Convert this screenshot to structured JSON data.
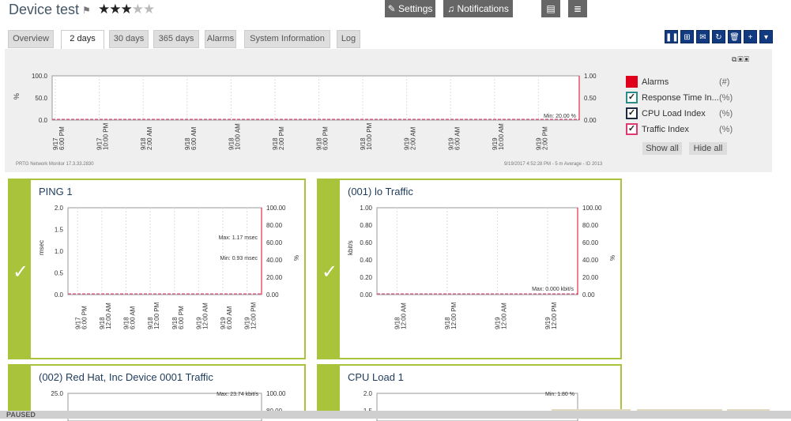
{
  "header": {
    "title": "Device test",
    "rating": 3,
    "rating_max": 5
  },
  "tabs": [
    {
      "label": "Overview"
    },
    {
      "label": "2 days",
      "active": true
    },
    {
      "label": "30 days"
    },
    {
      "label": "365 days"
    },
    {
      "label": "Alarms"
    },
    {
      "label": "System Information"
    },
    {
      "label": "Log"
    }
  ],
  "buttons": {
    "settings": "Settings",
    "notifications": "Notifications"
  },
  "toolbar_icons": [
    "pause-icon",
    "add-ticket-icon",
    "email-icon",
    "refresh-icon",
    "delete-icon",
    "add-icon",
    "dropdown-icon"
  ],
  "overview_chart": {
    "type": "line",
    "y_left": {
      "label": "%",
      "ticks": [
        "100.0",
        "50.0",
        "0.0"
      ]
    },
    "y_right": {
      "label": "#",
      "ticks": [
        "1.00",
        "0.50",
        "0.00"
      ]
    },
    "x_ticks": [
      [
        "9/17",
        "6:00 PM"
      ],
      [
        "9/17",
        "10:00 PM"
      ],
      [
        "9/18",
        "2:00 AM"
      ],
      [
        "9/18",
        "6:00 AM"
      ],
      [
        "9/18",
        "10:00 AM"
      ],
      [
        "9/18",
        "2:00 PM"
      ],
      [
        "9/18",
        "6:00 PM"
      ],
      [
        "9/18",
        "10:00 PM"
      ],
      [
        "9/19",
        "2:00 AM"
      ],
      [
        "9/19",
        "6:00 AM"
      ],
      [
        "9/19",
        "10:00 AM"
      ],
      [
        "9/19",
        "2:00 PM"
      ]
    ],
    "annotation": "Min: 20.00 %",
    "footer_left": "PRTG Network Monitor 17.3.33.2830",
    "footer_right": "9/19/2017 4:52:28 PM - 5 m Average - ID 2013",
    "colors": {
      "alarms": "#e0001c",
      "response": "#2a8b8b",
      "cpu": "#1b2a40",
      "traffic": "#e0396e"
    }
  },
  "legend": {
    "items": [
      {
        "label": "Alarms",
        "unit": "(#)",
        "checked": false
      },
      {
        "label": "Response Time In...",
        "unit": "(%)",
        "checked": true
      },
      {
        "label": "CPU Load Index",
        "unit": "(%)",
        "checked": true
      },
      {
        "label": "Traffic Index",
        "unit": "(%)",
        "checked": true
      }
    ],
    "show_all": "Show all",
    "hide_all": "Hide all"
  },
  "sensors": [
    {
      "title": "PING 1",
      "y_left_label": "msec",
      "y_left_ticks": [
        "2.0",
        "1.5",
        "1.0",
        "0.5",
        "0.0"
      ],
      "y_right_label": "%",
      "y_right_ticks": [
        "100.00",
        "80.00",
        "60.00",
        "40.00",
        "20.00",
        "0.00"
      ],
      "annotations": [
        "Max: 1.17 msec",
        "Min: 0.93 msec"
      ],
      "x_ticks": [
        [
          "9/17",
          "6:00 PM"
        ],
        [
          "9/18",
          "12:00 AM"
        ],
        [
          "9/18",
          "6:00 AM"
        ],
        [
          "9/18",
          "12:00 PM"
        ],
        [
          "9/18",
          "6:00 PM"
        ],
        [
          "9/19",
          "12:00 AM"
        ],
        [
          "9/19",
          "6:00 AM"
        ],
        [
          "9/19",
          "12:00 PM"
        ]
      ]
    },
    {
      "title": "(001) lo Traffic",
      "y_left_label": "kbit/s",
      "y_left_ticks": [
        "1.00",
        "0.80",
        "0.60",
        "0.40",
        "0.20",
        "0.00"
      ],
      "y_right_label": "%",
      "y_right_ticks": [
        "100.00",
        "80.00",
        "60.00",
        "40.00",
        "20.00",
        "0.00"
      ],
      "annotations": [
        "Max: 0.000 kbit/s"
      ],
      "x_ticks": [
        [
          "9/18",
          "12:00 AM"
        ],
        [
          "9/18",
          "12:00 PM"
        ],
        [
          "9/19",
          "12:00 AM"
        ],
        [
          "9/19",
          "12:00 PM"
        ]
      ]
    },
    {
      "title": "(002) Red Hat, Inc Device 0001 Traffic",
      "y_left_ticks": [
        "25.0"
      ],
      "y_right_ticks": [
        "100.00",
        "80.00"
      ],
      "annotations": [
        "Max: 23.74 kbit/s"
      ]
    },
    {
      "title": "CPU Load 1",
      "y_left_ticks": [
        "2.0",
        "1.5"
      ],
      "annotations": [
        "Min: 1.80 %"
      ]
    }
  ],
  "bottom_bar": "PAUSED"
}
